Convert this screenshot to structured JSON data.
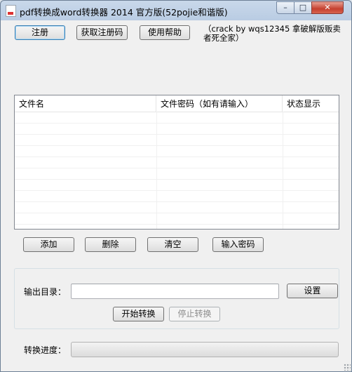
{
  "window": {
    "title": "pdf转换成word转换器 2014 官方版(52pojie和谐版)",
    "controls": {
      "minimize": "–",
      "maximize": "□",
      "close": "✕"
    }
  },
  "top_buttons": {
    "register": "注册",
    "get_code": "获取注册码",
    "help": "使用帮助"
  },
  "crack_note": "（crack by wqs12345 拿破解版贩卖者死全家）",
  "file_list": {
    "columns": [
      "文件名",
      "文件密码（如有请输入）",
      "状态显示"
    ],
    "rows": []
  },
  "list_buttons": {
    "add": "添加",
    "delete": "删除",
    "clear": "清空",
    "input_password": "输入密码"
  },
  "output": {
    "label": "输出目录：",
    "value": "",
    "settings": "设置"
  },
  "convert_buttons": {
    "start": "开始转换",
    "stop": "停止转换"
  },
  "progress": {
    "label": "转换进度：",
    "value": 0
  },
  "colors": {
    "title_bar": "#b9cce3",
    "close_button": "#c5402f",
    "client_bg": "#f0f0f0",
    "default_button_border": "#3c7fb1"
  }
}
